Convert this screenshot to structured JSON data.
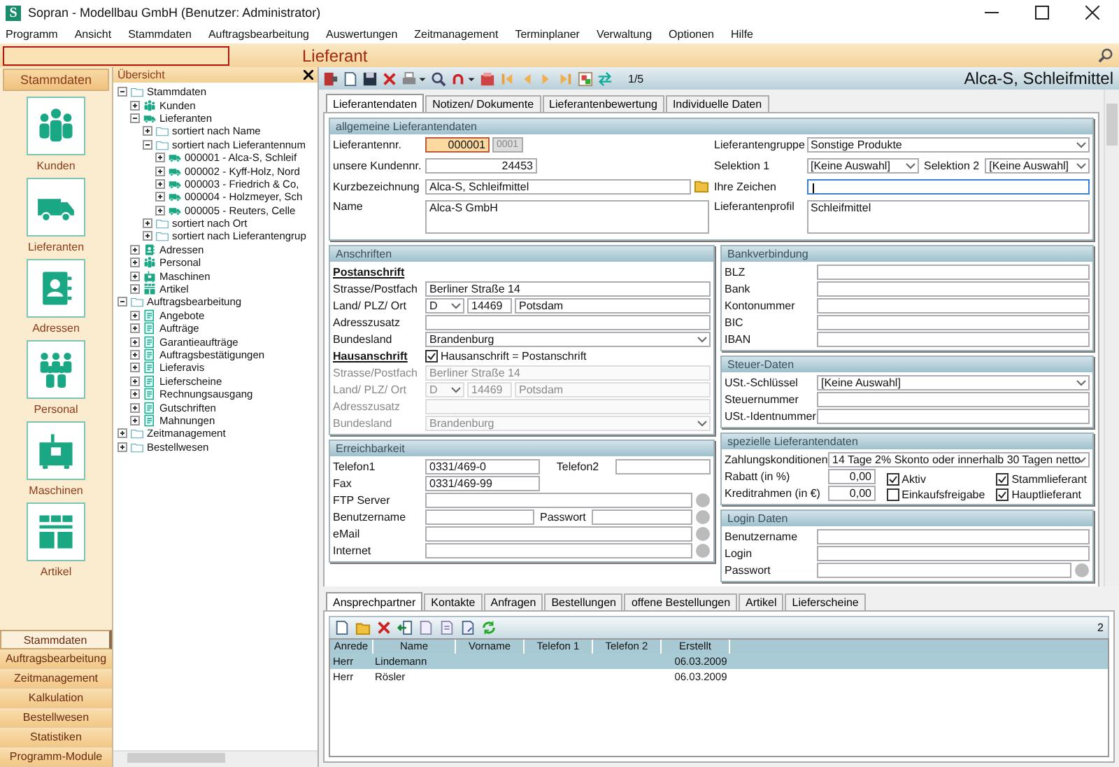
{
  "window": {
    "app_icon": "S",
    "title": "Sopran - Modellbau GmbH (Benutzer: Administrator)"
  },
  "menu": [
    "Programm",
    "Ansicht",
    "Stammdaten",
    "Auftragsbearbeitung",
    "Auswertungen",
    "Zeitmanagement",
    "Terminplaner",
    "Verwaltung",
    "Optionen",
    "Hilfe"
  ],
  "header": {
    "title": "Lieferant"
  },
  "sidebar": {
    "title": "Stammdaten",
    "items": [
      {
        "label": "Kunden",
        "kind": "people"
      },
      {
        "label": "Lieferanten",
        "kind": "truck"
      },
      {
        "label": "Adressen",
        "kind": "card"
      },
      {
        "label": "Personal",
        "kind": "group"
      },
      {
        "label": "Maschinen",
        "kind": "machine"
      },
      {
        "label": "Artikel",
        "kind": "shelf"
      }
    ],
    "modules": [
      {
        "label": "Stammdaten",
        "selected": true
      },
      {
        "label": "Auftragsbearbeitung",
        "selected": false
      },
      {
        "label": "Zeitmanagement",
        "selected": false
      },
      {
        "label": "Kalkulation",
        "selected": false
      },
      {
        "label": "Bestellwesen",
        "selected": false
      },
      {
        "label": "Statistiken",
        "selected": false
      },
      {
        "label": "Programm-Module",
        "selected": false
      }
    ]
  },
  "tree": {
    "title": "Übersicht",
    "nodes": [
      {
        "label": "Stammdaten",
        "kind": "folder",
        "expanded": true,
        "children": [
          {
            "label": "Kunden",
            "kind": "people",
            "expanded": false
          },
          {
            "label": "Lieferanten",
            "kind": "truck",
            "expanded": true,
            "children": [
              {
                "label": "sortiert nach Name",
                "kind": "folder",
                "expanded": false
              },
              {
                "label": "sortiert nach Lieferantennum",
                "kind": "folder",
                "expanded": true,
                "children": [
                  {
                    "label": "000001 - Alca-S, Schleif",
                    "kind": "truck",
                    "expanded": false
                  },
                  {
                    "label": "000002 - Kyff-Holz, Nord",
                    "kind": "truck",
                    "expanded": false
                  },
                  {
                    "label": "000003 - Friedrich & Co,",
                    "kind": "truck",
                    "expanded": false
                  },
                  {
                    "label": "000004 - Holzmeyer, Sch",
                    "kind": "truck",
                    "expanded": false
                  },
                  {
                    "label": "000005 - Reuters, Celle",
                    "kind": "truck",
                    "expanded": false
                  }
                ]
              },
              {
                "label": "sortiert nach Ort",
                "kind": "folder",
                "expanded": false
              },
              {
                "label": "sortiert nach Lieferantengrup",
                "kind": "folder",
                "expanded": false
              }
            ]
          },
          {
            "label": "Adressen",
            "kind": "card",
            "expanded": false
          },
          {
            "label": "Personal",
            "kind": "people",
            "expanded": false
          },
          {
            "label": "Maschinen",
            "kind": "machine",
            "expanded": false
          },
          {
            "label": "Artikel",
            "kind": "shelf",
            "expanded": false
          }
        ]
      },
      {
        "label": "Auftragsbearbeitung",
        "kind": "folder",
        "expanded": true,
        "children": [
          {
            "label": "Angebote",
            "kind": "document",
            "expanded": false
          },
          {
            "label": "Aufträge",
            "kind": "document",
            "expanded": false
          },
          {
            "label": "Garantieaufträge",
            "kind": "document",
            "expanded": false
          },
          {
            "label": "Auftragsbestätigungen",
            "kind": "document",
            "expanded": false
          },
          {
            "label": "Lieferavis",
            "kind": "document",
            "expanded": false
          },
          {
            "label": "Lieferscheine",
            "kind": "document",
            "expanded": false
          },
          {
            "label": "Rechnungsausgang",
            "kind": "document",
            "expanded": false
          },
          {
            "label": "Gutschriften",
            "kind": "document",
            "expanded": false
          },
          {
            "label": "Mahnungen",
            "kind": "document",
            "expanded": false
          }
        ]
      },
      {
        "label": "Zeitmanagement",
        "kind": "folder",
        "expanded": false
      },
      {
        "label": "Bestellwesen",
        "kind": "folder",
        "expanded": false
      }
    ]
  },
  "record": {
    "counter": "1/5",
    "title": "Alca-S, Schleifmittel"
  },
  "main_tabs": [
    {
      "label": "Lieferantendaten",
      "selected": true
    },
    {
      "label": "Notizen/ Dokumente",
      "selected": false
    },
    {
      "label": "Lieferantenbewertung",
      "selected": false
    },
    {
      "label": "Individuelle Daten",
      "selected": false
    }
  ],
  "general": {
    "title": "allgemeine Lieferantendaten",
    "supplier_no": {
      "label": "Lieferantennr.",
      "value": "000001",
      "button": "0001"
    },
    "customer_no": {
      "label": "unsere Kundennr.",
      "value": "24453"
    },
    "short_name": {
      "label": "Kurzbezeichnung",
      "value": "Alca-S, Schleifmittel"
    },
    "name": {
      "label": "Name",
      "value": "Alca-S GmbH"
    },
    "group": {
      "label": "Lieferantengruppe",
      "value": "Sonstige Produkte"
    },
    "selection1": {
      "label": "Selektion 1",
      "value": "[Keine Auswahl]"
    },
    "selection2": {
      "label": "Selektion 2",
      "value": "[Keine Auswahl]"
    },
    "your_ref": {
      "label": "Ihre Zeichen",
      "focused": true
    },
    "profile": {
      "label": "Lieferantenprofil",
      "value": "Schleifmittel"
    }
  },
  "addresses": {
    "title": "Anschriften",
    "postal": {
      "heading": "Postanschrift",
      "street": {
        "label": "Strasse/Postfach",
        "value": "Berliner Straße 14"
      },
      "location": {
        "label": "Land/ PLZ/ Ort",
        "country": "D",
        "zip": "14469",
        "city": "Potsdam"
      },
      "extra": {
        "label": "Adresszusatz"
      },
      "state": {
        "label": "Bundesland",
        "value": "Brandenburg"
      }
    },
    "house": {
      "heading": "Hausanschrift",
      "same_as_postal": {
        "label": "Hausanschrift = Postanschrift",
        "checked": true
      },
      "street": {
        "label": "Strasse/Postfach",
        "value": "Berliner Straße 14"
      },
      "location": {
        "label": "Land/ PLZ/ Ort",
        "country": "D",
        "zip": "14469",
        "city": "Potsdam"
      },
      "extra": {
        "label": "Adresszusatz"
      },
      "state": {
        "label": "Bundesland",
        "value": "Brandenburg"
      }
    }
  },
  "contact": {
    "title": "Erreichbarkeit",
    "phone1": {
      "label": "Telefon1",
      "value": "0331/469-0"
    },
    "phone2": {
      "label": "Telefon2"
    },
    "fax": {
      "label": "Fax",
      "value": "0331/469-99"
    },
    "ftp": {
      "label": "FTP Server"
    },
    "user": {
      "label": "Benutzername"
    },
    "password": {
      "label": "Passwort"
    },
    "email": {
      "label": "eMail"
    },
    "internet": {
      "label": "Internet"
    }
  },
  "bank": {
    "title": "Bankverbindung",
    "fields": [
      {
        "label": "BLZ"
      },
      {
        "label": "Bank"
      },
      {
        "label": "Kontonummer"
      },
      {
        "label": "BIC"
      },
      {
        "label": "IBAN"
      }
    ]
  },
  "tax": {
    "title": "Steuer-Daten",
    "key": {
      "label": "USt.-Schlüssel",
      "value": "[Keine Auswahl]"
    },
    "fields": [
      {
        "label": "Steuernummer"
      },
      {
        "label": "USt.-Identnummer"
      }
    ]
  },
  "special": {
    "title": "spezielle Lieferantendaten",
    "payment": {
      "label": "Zahlungskonditionen",
      "value": "14 Tage 2% Skonto oder innerhalb 30 Tagen netto"
    },
    "discount": {
      "label": "Rabatt (in %)",
      "value": "0,00"
    },
    "credit": {
      "label": "Kreditrahmen (in €)",
      "value": "0,00"
    },
    "flags": [
      {
        "label": "Aktiv",
        "checked": true
      },
      {
        "label": "Stammlieferant",
        "checked": true
      },
      {
        "label": "Einkaufsfreigabe",
        "checked": false
      },
      {
        "label": "Hauptlieferant",
        "checked": true
      }
    ]
  },
  "login": {
    "title": "Login Daten",
    "fields": [
      {
        "label": "Benutzername"
      },
      {
        "label": "Login"
      },
      {
        "label": "Passwort"
      }
    ]
  },
  "bottom": {
    "tabs": [
      {
        "label": "Ansprechpartner",
        "selected": true
      },
      {
        "label": "Kontakte",
        "selected": false
      },
      {
        "label": "Anfragen",
        "selected": false
      },
      {
        "label": "Bestellungen",
        "selected": false
      },
      {
        "label": "offene Bestellungen",
        "selected": false
      },
      {
        "label": "Artikel",
        "selected": false
      },
      {
        "label": "Lieferscheine",
        "selected": false
      }
    ],
    "count": "2",
    "columns": [
      "Anrede",
      "Name",
      "Vorname",
      "Telefon 1",
      "Telefon 2",
      "Erstellt"
    ],
    "rows": [
      {
        "salutation": "Herr",
        "name": "Lindemann",
        "created": "06.03.2009",
        "selected": true
      },
      {
        "salutation": "Herr",
        "name": "Rösler",
        "created": "06.03.2009",
        "selected": false
      }
    ]
  }
}
